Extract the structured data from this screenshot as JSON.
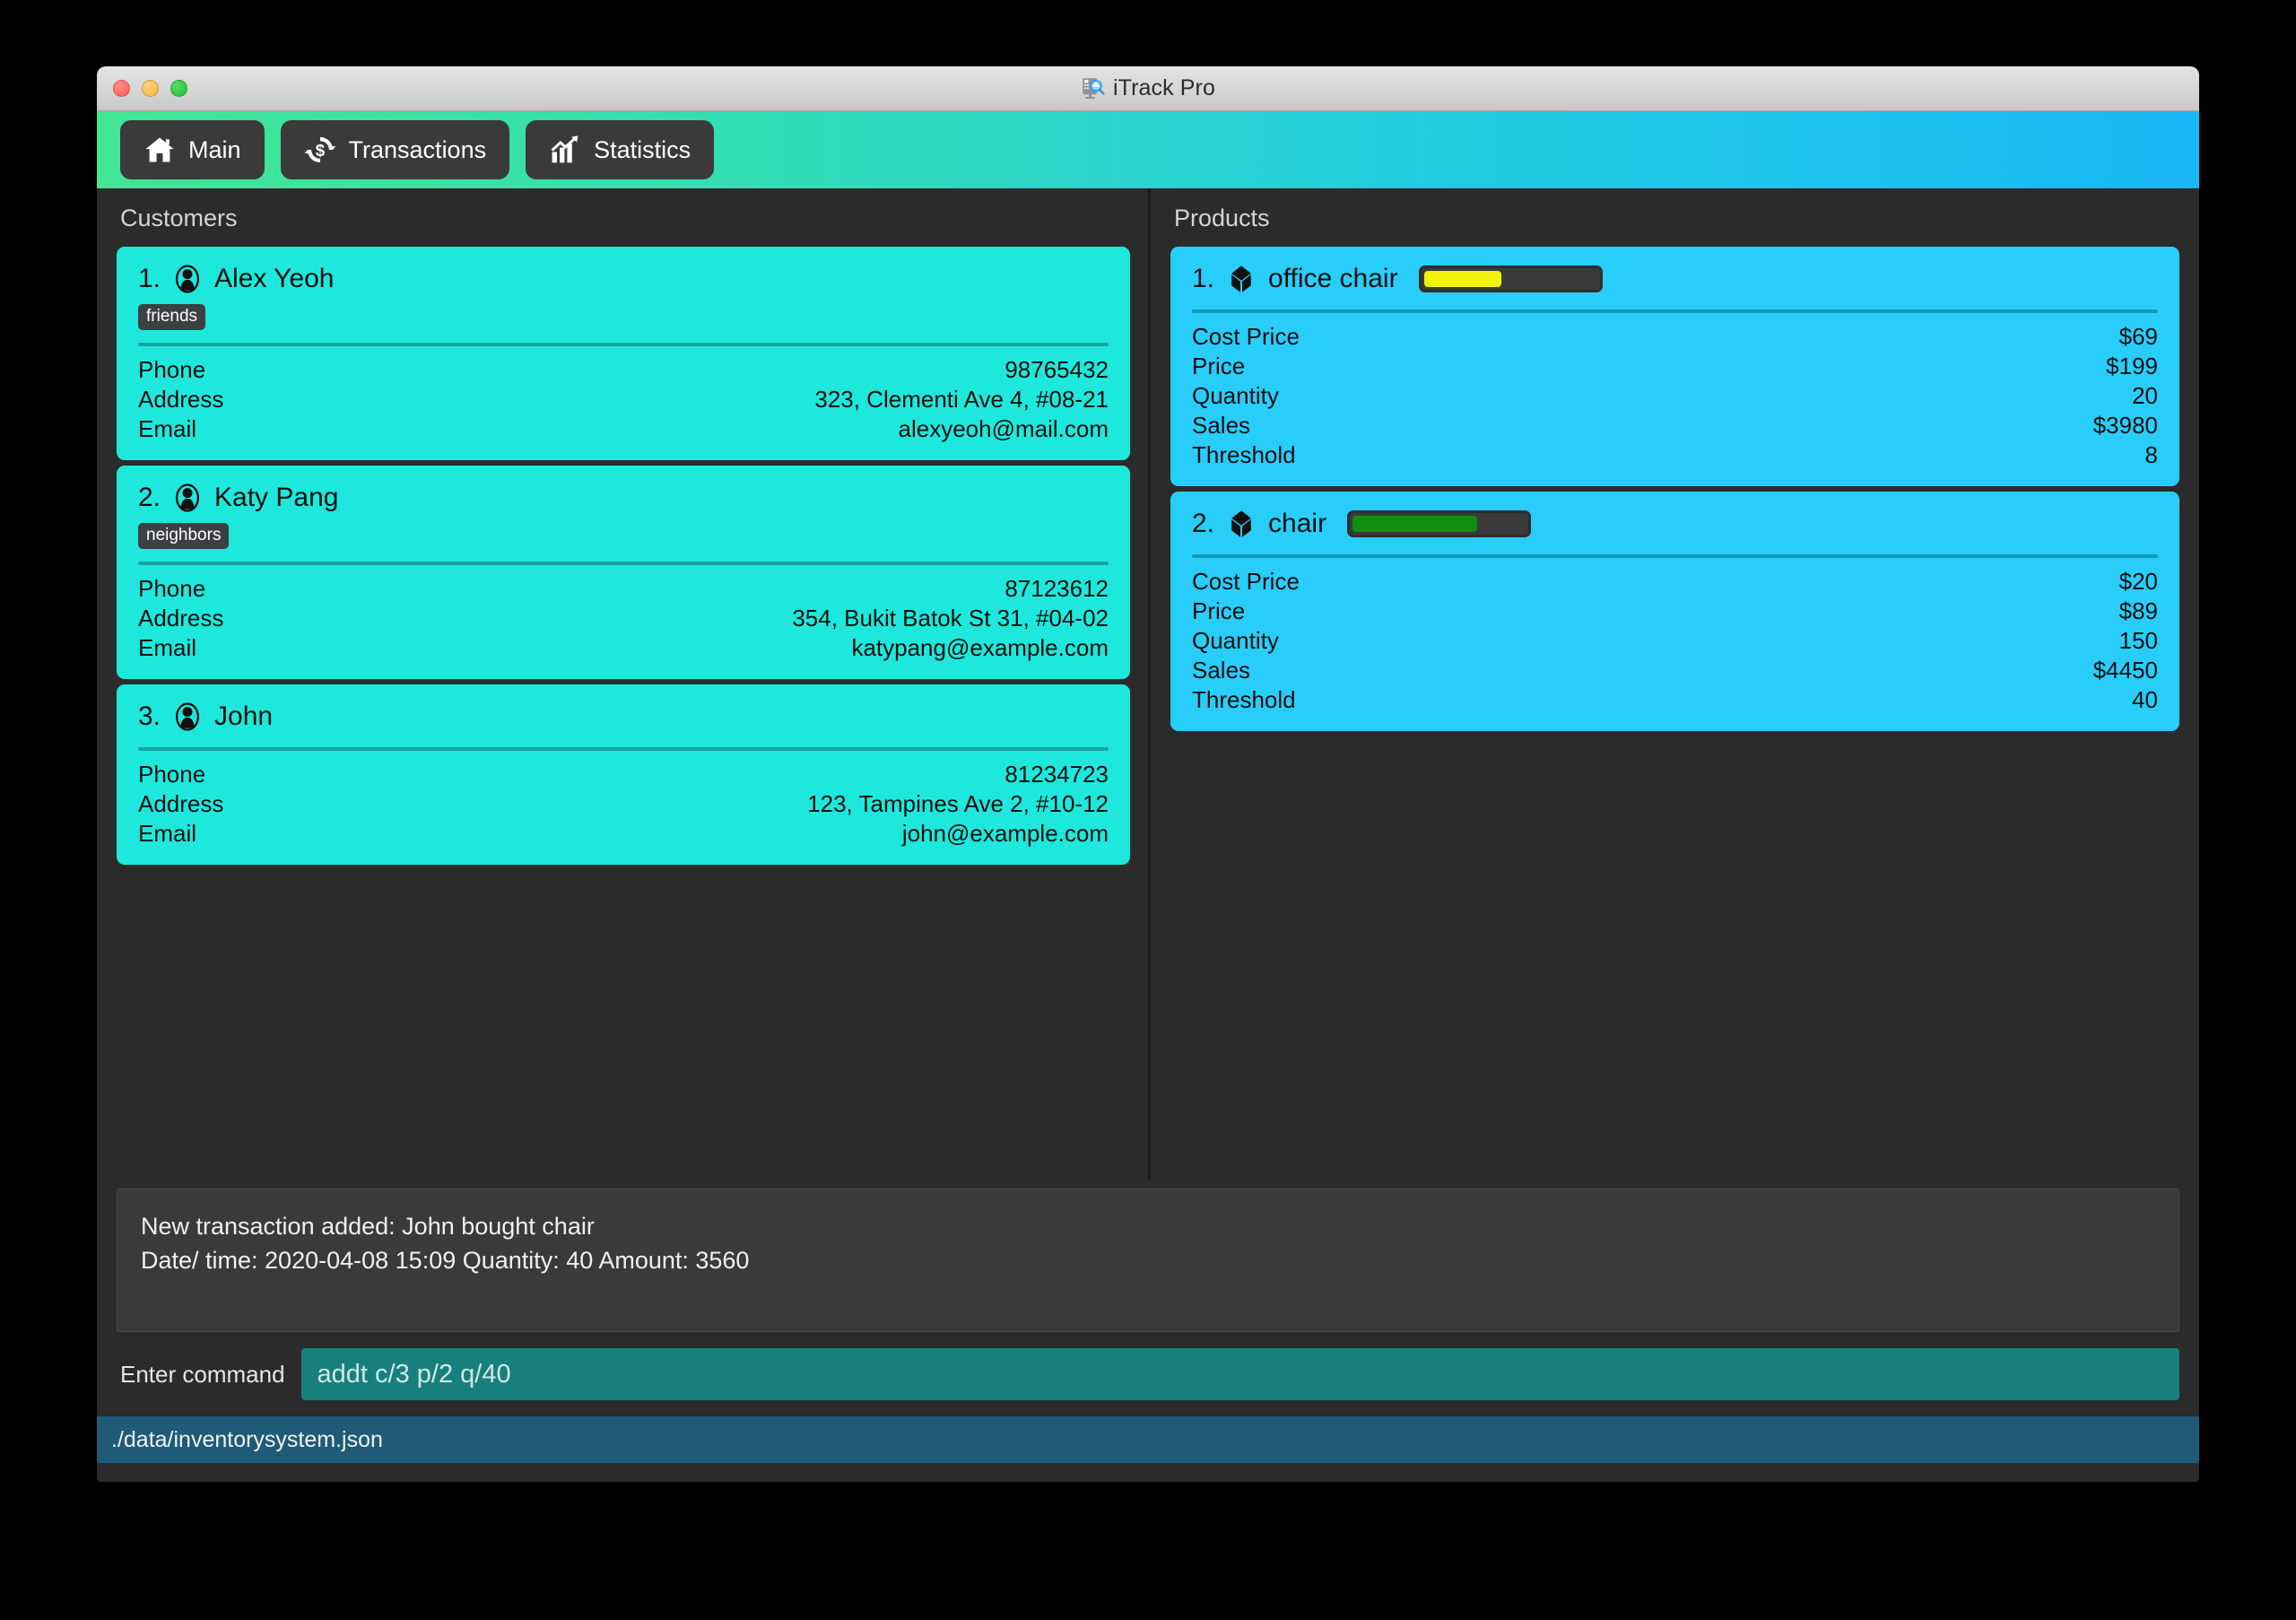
{
  "window": {
    "title": "iTrack Pro",
    "title_icon": "document-search-icon",
    "traffic_lights": [
      "close-button",
      "minimize-button",
      "maximize-button"
    ]
  },
  "nav": {
    "items": [
      {
        "label": "Main",
        "icon": "home-icon"
      },
      {
        "label": "Transactions",
        "icon": "dollar-refresh-icon"
      },
      {
        "label": "Statistics",
        "icon": "chart-growth-icon"
      }
    ]
  },
  "customers_pane": {
    "title": "Customers",
    "field_labels": {
      "phone": "Phone",
      "address": "Address",
      "email": "Email"
    },
    "items": [
      {
        "index": "1.",
        "name": "Alex Yeoh",
        "tags": [
          "friends"
        ],
        "phone": "98765432",
        "address": "323, Clementi Ave 4, #08-21",
        "email": "alexyeoh@mail.com"
      },
      {
        "index": "2.",
        "name": "Katy Pang",
        "tags": [
          "neighbors"
        ],
        "phone": "87123612",
        "address": "354, Bukit Batok St 31, #04-02",
        "email": "katypang@example.com"
      },
      {
        "index": "3.",
        "name": "John",
        "tags": [],
        "phone": "81234723",
        "address": "123, Tampines Ave 2, #10-12",
        "email": "john@example.com"
      }
    ]
  },
  "products_pane": {
    "title": "Products",
    "field_labels": {
      "cost_price": "Cost Price",
      "price": "Price",
      "quantity": "Quantity",
      "sales": "Sales",
      "threshold": "Threshold"
    },
    "items": [
      {
        "index": "1.",
        "name": "office chair",
        "cost_price": "$69",
        "price": "$199",
        "quantity": "20",
        "sales": "$3980",
        "threshold": "8",
        "stock_percent": 45,
        "stock_color": "#f2f20d"
      },
      {
        "index": "2.",
        "name": "chair",
        "cost_price": "$20",
        "price": "$89",
        "quantity": "150",
        "sales": "$4450",
        "threshold": "40",
        "stock_percent": 72,
        "stock_color": "#0f8f0f"
      }
    ]
  },
  "result_box": {
    "line1": "New transaction added: John bought chair",
    "line2": "Date/ time: 2020-04-08 15:09 Quantity: 40 Amount: 3560"
  },
  "command": {
    "label": "Enter command",
    "value": "addt c/3 p/2 q/40",
    "placeholder": "addt c/3 p/2 q/40"
  },
  "status_bar": {
    "file_path": "./data/inventorysystem.json"
  },
  "colors": {
    "header_gradient_start": "#42e695",
    "header_gradient_end": "#17b8f6",
    "customer_card": "#1ee8dc",
    "product_card": "#29cdfa",
    "command_field": "#17807c",
    "status_bar": "#1f5b77",
    "panel_bg": "#2b2b2b"
  }
}
